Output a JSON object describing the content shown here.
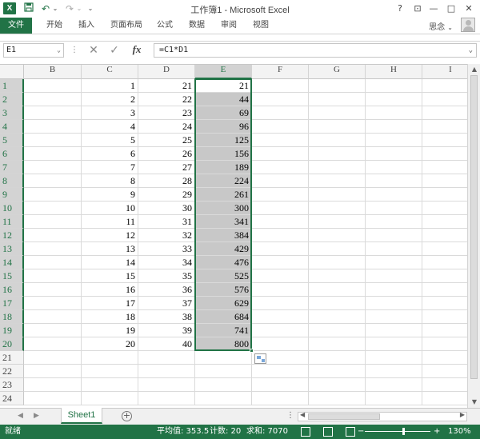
{
  "window": {
    "title": "工作簿1 - Microsoft Excel",
    "logo": "X",
    "help": "?",
    "min": "—",
    "max": "□",
    "close": "✕",
    "restore": "⊡"
  },
  "qat": {
    "save_icon": "save-icon",
    "undo": "↶",
    "redo": "↷",
    "customize": "⌄"
  },
  "ribbon": {
    "tabs": [
      "文件",
      "开始",
      "插入",
      "页面布局",
      "公式",
      "数据",
      "审阅",
      "视图"
    ],
    "user": "思念"
  },
  "formula_bar": {
    "name_box": "E1",
    "cancel": "✕",
    "enter": "✓",
    "fx": "fx",
    "formula": "=C1*D1"
  },
  "columns": [
    "B",
    "C",
    "D",
    "E",
    "F",
    "G",
    "H",
    "I"
  ],
  "selected_column": "E",
  "rows": [
    {
      "n": "1",
      "C": "1",
      "D": "21",
      "E": "21"
    },
    {
      "n": "2",
      "C": "2",
      "D": "22",
      "E": "44"
    },
    {
      "n": "3",
      "C": "3",
      "D": "23",
      "E": "69"
    },
    {
      "n": "4",
      "C": "4",
      "D": "24",
      "E": "96"
    },
    {
      "n": "5",
      "C": "5",
      "D": "25",
      "E": "125"
    },
    {
      "n": "6",
      "C": "6",
      "D": "26",
      "E": "156"
    },
    {
      "n": "7",
      "C": "7",
      "D": "27",
      "E": "189"
    },
    {
      "n": "8",
      "C": "8",
      "D": "28",
      "E": "224"
    },
    {
      "n": "9",
      "C": "9",
      "D": "29",
      "E": "261"
    },
    {
      "n": "10",
      "C": "10",
      "D": "30",
      "E": "300"
    },
    {
      "n": "11",
      "C": "11",
      "D": "31",
      "E": "341"
    },
    {
      "n": "12",
      "C": "12",
      "D": "32",
      "E": "384"
    },
    {
      "n": "13",
      "C": "13",
      "D": "33",
      "E": "429"
    },
    {
      "n": "14",
      "C": "14",
      "D": "34",
      "E": "476"
    },
    {
      "n": "15",
      "C": "15",
      "D": "35",
      "E": "525"
    },
    {
      "n": "16",
      "C": "16",
      "D": "36",
      "E": "576"
    },
    {
      "n": "17",
      "C": "17",
      "D": "37",
      "E": "629"
    },
    {
      "n": "18",
      "C": "18",
      "D": "38",
      "E": "684"
    },
    {
      "n": "19",
      "C": "19",
      "D": "39",
      "E": "741"
    },
    {
      "n": "20",
      "C": "20",
      "D": "40",
      "E": "800"
    },
    {
      "n": "21",
      "C": "",
      "D": "",
      "E": ""
    },
    {
      "n": "22",
      "C": "",
      "D": "",
      "E": ""
    },
    {
      "n": "23",
      "C": "",
      "D": "",
      "E": ""
    },
    {
      "n": "24",
      "C": "",
      "D": "",
      "E": ""
    }
  ],
  "sheets": {
    "active": "Sheet1",
    "add": "+",
    "prev": "◀",
    "next": "▶",
    "more": "⋮"
  },
  "status": {
    "mode": "就绪",
    "average": "平均值: 353.5",
    "count": "计数: 20",
    "sum": "求和: 7070",
    "zoom_minus": "−",
    "zoom_plus": "+",
    "zoom": "130%",
    "zoom_level": 130
  },
  "colors": {
    "accent": "#217346",
    "selection_shade": "#c8c8c8"
  }
}
